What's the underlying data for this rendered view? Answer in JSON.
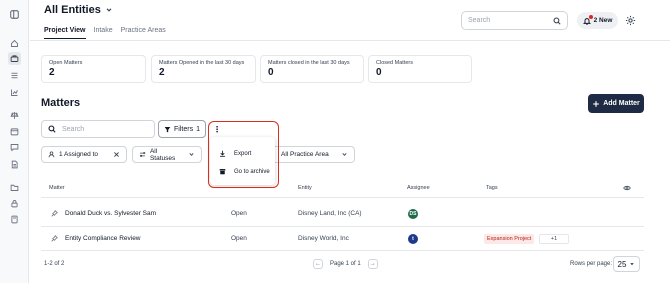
{
  "header": {
    "title": "All Entities",
    "tabs": [
      {
        "label": "Project View",
        "active": true
      },
      {
        "label": "Intake",
        "active": false
      },
      {
        "label": "Practice Areas",
        "active": false
      }
    ],
    "search_placeholder": "Search",
    "notifications_label": "2 New"
  },
  "stats": [
    {
      "label": "Open Matters",
      "value": "2"
    },
    {
      "label": "Matters Opened in the last 30 days",
      "value": "2"
    },
    {
      "label": "Matters closed in the last 30 days",
      "value": "0"
    },
    {
      "label": "Closed Matters",
      "value": "0"
    }
  ],
  "matters": {
    "title": "Matters",
    "add_label": "Add Matter",
    "search_placeholder": "Search",
    "filters_label": "Filters",
    "filters_count": "1",
    "kebab": "⋮",
    "menu": [
      {
        "label": "Export",
        "icon": "download-icon"
      },
      {
        "label": "Go to archive",
        "icon": "archive-icon"
      }
    ],
    "chips": {
      "assigned": "1 Assigned to",
      "statuses": "All Statuses",
      "practice": "All Practice Area"
    }
  },
  "table": {
    "columns": {
      "matter": "Matter",
      "entity": "Entity",
      "assignee": "Assignee",
      "tags": "Tags"
    },
    "rows": [
      {
        "matter": "Donald Duck vs. Sylvester Sam",
        "status": "Open",
        "entity": "Disney Land, Inc (CA)",
        "assignee": "DS",
        "assignee_color": "#1f6b4a",
        "tags": []
      },
      {
        "matter": "Entity Compliance Review",
        "status": "Open",
        "entity": "Disney World, Inc",
        "assignee": "t",
        "assignee_color": "#1e3a8a",
        "tags": [
          "Expansion Project"
        ],
        "more_tags": "+1"
      }
    ]
  },
  "footer": {
    "count": "1-2 of 2",
    "page_label": "Page 1 of 1",
    "rows_per_page_label": "Rows per page:",
    "rows_per_page": "25"
  },
  "colors": {
    "accent": "#1f2a44",
    "highlight": "#d92d20",
    "tag_bg": "#fde8e8",
    "tag_text": "#b42318"
  }
}
